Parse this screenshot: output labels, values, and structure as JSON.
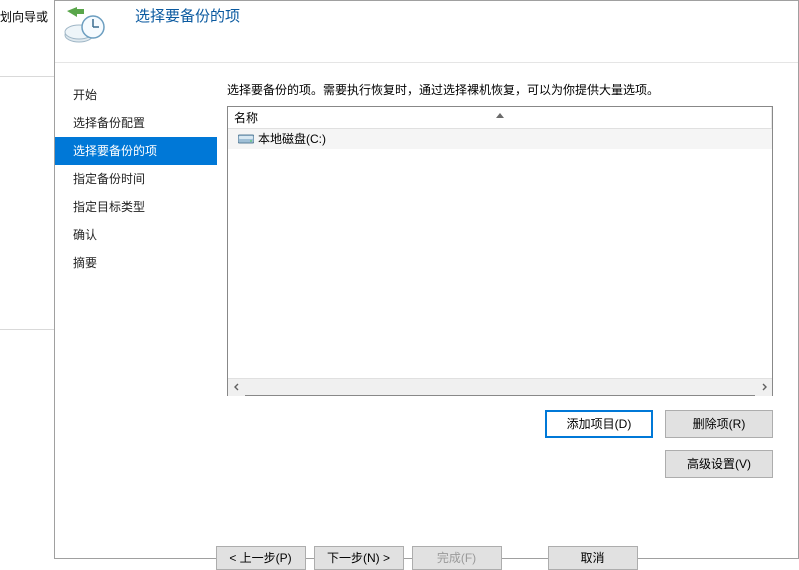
{
  "outside_label": "划向导或",
  "header": {
    "title": "选择要备份的项"
  },
  "sidebar": {
    "items": [
      {
        "label": "开始"
      },
      {
        "label": "选择备份配置"
      },
      {
        "label": "选择要备份的项"
      },
      {
        "label": "指定备份时间"
      },
      {
        "label": "指定目标类型"
      },
      {
        "label": "确认"
      },
      {
        "label": "摘要"
      }
    ],
    "active_index": 2
  },
  "main": {
    "description": "选择要备份的项。需要执行恢复时，通过选择裸机恢复，可以为你提供大量选项。",
    "column_name": "名称",
    "rows": [
      {
        "label": "本地磁盘(C:)"
      }
    ],
    "buttons": {
      "add": "添加项目(D)",
      "remove": "删除项(R)",
      "advanced": "高级设置(V)"
    }
  },
  "footer": {
    "prev": "< 上一步(P)",
    "next": "下一步(N) >",
    "finish": "完成(F)",
    "cancel": "取消"
  }
}
